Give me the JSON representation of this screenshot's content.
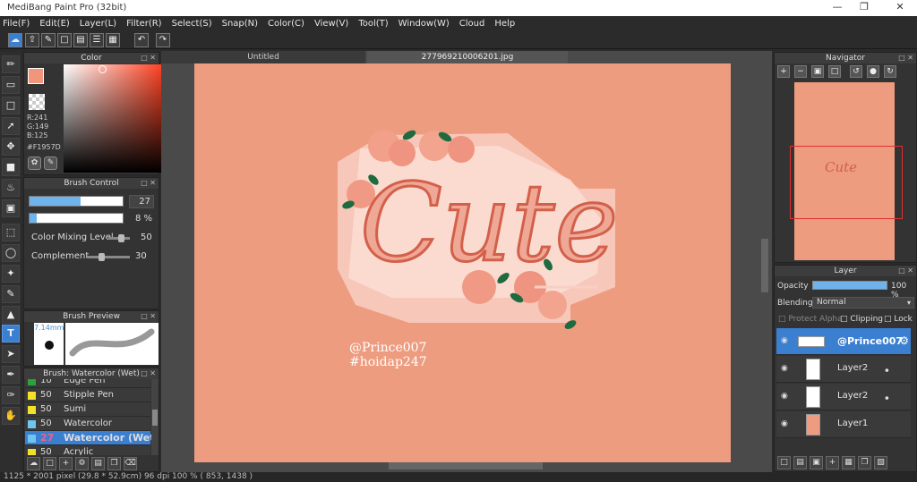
{
  "app": {
    "title": "MediBang Paint Pro (32bit)"
  },
  "menu": [
    "File(F)",
    "Edit(E)",
    "Layer(L)",
    "Filter(R)",
    "Select(S)",
    "Snap(N)",
    "Color(C)",
    "View(V)",
    "Tool(T)",
    "Window(W)",
    "Cloud",
    "Help"
  ],
  "color_panel": {
    "title": "Color",
    "r": "R:241",
    "g": "G:149",
    "b": "B:125",
    "hex": "#F1957D",
    "foreground": "#f1957d"
  },
  "brush_control": {
    "title": "Brush Control",
    "size_value": "27",
    "size_fill": 0.55,
    "opacity_value": "8 %",
    "opacity_fill": 0.08,
    "mixing_label": "Color Mixing Level",
    "mixing_value": "50",
    "complement_label": "Complement",
    "complement_value": "30"
  },
  "brush_preview": {
    "title": "Brush Preview",
    "size_text": "7.14mm"
  },
  "brush_list": {
    "title": "Brush: Watercolor (Wet)",
    "items": [
      {
        "size": "10",
        "name": "Edge Pen",
        "color": "#2aa43a"
      },
      {
        "size": "50",
        "name": "Stipple Pen",
        "color": "#f2e12a"
      },
      {
        "size": "50",
        "name": "Sumi",
        "color": "#f2e12a"
      },
      {
        "size": "50",
        "name": "Watercolor",
        "color": "#6ec6ef"
      },
      {
        "size": "27",
        "name": "Watercolor (Wet)",
        "color": "#6ec6ef"
      },
      {
        "size": "50",
        "name": "Acrylic",
        "color": "#f2e12a"
      }
    ]
  },
  "tabs": {
    "untitled": "Untitled",
    "active": "277969210006201.jpg"
  },
  "artwork": {
    "word": "Cute",
    "credit1": "@Prince007",
    "credit2": "#hoidap247",
    "bg": "#ee9c80"
  },
  "navigator": {
    "title": "Navigator"
  },
  "layer_panel": {
    "title": "Layer",
    "opacity_label": "Opacity",
    "opacity_value": "100 %",
    "blending_label": "Blending",
    "blending_value": "Normal",
    "protect_alpha": "Protect Alpha",
    "clipping": "Clipping",
    "lock": "Lock",
    "layers": [
      {
        "name": "@Prince007",
        "selected": true
      },
      {
        "name": "Layer2",
        "selected": false
      },
      {
        "name": "Layer2",
        "selected": false
      },
      {
        "name": "Layer1",
        "selected": false
      }
    ]
  },
  "status": {
    "text": "1125 * 2001 pixel   (29.8 * 52.9cm)   96 dpi   100 %   ( 853, 1438 )"
  }
}
